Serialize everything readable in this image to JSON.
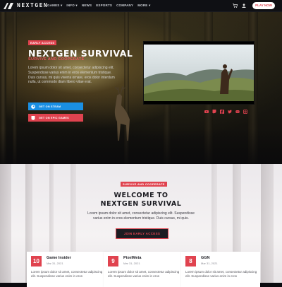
{
  "brand": {
    "logo_text": "NEXTGEN"
  },
  "nav": {
    "items": [
      "GAMES ▾",
      "INFO ▾",
      "NEWS",
      "ESPORTS",
      "COMPANY",
      "MORE ▾"
    ],
    "play_button": "PLAY NOW"
  },
  "hero": {
    "badge": "EARLY ACCESS",
    "title": "NEXTGEN SURVIVAL",
    "subtitle": "SURVIVE AND COOPERATE",
    "text": "Lorem ipsum dolor sit amet, consectetur adipiscing elit. Suspendisse varius enim in eros elementum tristique. Duis cursus, mi quis viverra ornare, eros dolor interdum nulla, ut commodo diam libero vitae erat.",
    "steam_button": "GET ON STEAM",
    "epic_button": "GET ON EPIC GAMES"
  },
  "welcome": {
    "badge": "SURVIVE AND COOPERATE",
    "title_line1": "WELCOME TO",
    "title_line2": "NEXTGEN SURVIVAL",
    "text": "Lorem ipsum dolor sit amet, consectetur adipiscing elit. Suspendisse varius enim in eros elementum tristique. Duis cursus, mi quis.",
    "join_button": "JOIN EARLY ACCESS"
  },
  "reviews": [
    {
      "score": "10",
      "name": "Game Insider",
      "date": "Mar 31, 2021",
      "text": "Lorem ipsum dolor sit amet, consectetur adipiscing elit. Suspendisse varius enim in eros"
    },
    {
      "score": "9",
      "name": "PixelMeta",
      "date": "Mar 31, 2021",
      "text": "Lorem ipsum dolor sit amet, consectetur adipiscing elit. Suspendisse varius enim in eros"
    },
    {
      "score": "8",
      "name": "GGN",
      "date": "Mar 31, 2021",
      "text": "Lorem ipsum dolor sit amet, consectetur adipiscing elit. Suspendisse varius enim in eros"
    }
  ],
  "icons": {
    "nav": [
      "cart-icon",
      "user-icon"
    ],
    "social": [
      "youtube-icon",
      "twitch-icon",
      "facebook-icon",
      "twitter-icon",
      "discord-icon",
      "instagram-icon"
    ]
  },
  "colors": {
    "accent": "#e0434f",
    "steam": "#1a8fe3",
    "epic": "#e0434f",
    "dark": "#1c1c22"
  }
}
